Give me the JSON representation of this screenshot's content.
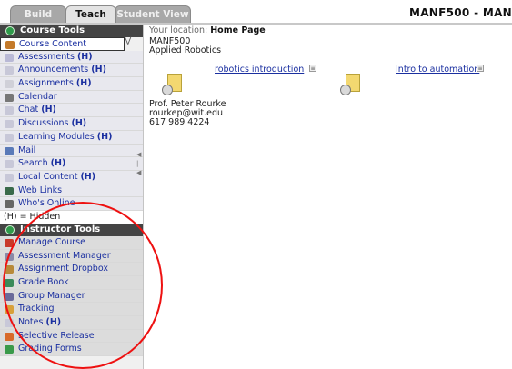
{
  "tabs": [
    {
      "label": "Build"
    },
    {
      "label": "Teach"
    },
    {
      "label": "Student View"
    }
  ],
  "course_title": "MANF500 - MAN",
  "course_tools": {
    "header": "Course Tools",
    "items": [
      {
        "label": "Course Content",
        "hidden": ""
      },
      {
        "label": "Assessments",
        "hidden": "(H)"
      },
      {
        "label": "Announcements",
        "hidden": "(H)"
      },
      {
        "label": "Assignments",
        "hidden": "(H)"
      },
      {
        "label": "Calendar",
        "hidden": ""
      },
      {
        "label": "Chat",
        "hidden": "(H)"
      },
      {
        "label": "Discussions",
        "hidden": "(H)"
      },
      {
        "label": "Learning Modules",
        "hidden": "(H)"
      },
      {
        "label": "Mail",
        "hidden": ""
      },
      {
        "label": "Search",
        "hidden": "(H)"
      },
      {
        "label": "Local Content",
        "hidden": "(H)"
      },
      {
        "label": "Web Links",
        "hidden": ""
      },
      {
        "label": "Who's Online",
        "hidden": ""
      }
    ],
    "hidden_note": "(H) = Hidden"
  },
  "instructor_tools": {
    "header": "Instructor Tools",
    "items": [
      {
        "label": "Manage Course",
        "hidden": ""
      },
      {
        "label": "Assessment Manager",
        "hidden": ""
      },
      {
        "label": "Assignment Dropbox",
        "hidden": ""
      },
      {
        "label": "Grade Book",
        "hidden": ""
      },
      {
        "label": "Group Manager",
        "hidden": ""
      },
      {
        "label": "Tracking",
        "hidden": ""
      },
      {
        "label": "Notes",
        "hidden": "(H)"
      },
      {
        "label": "Selective Release",
        "hidden": ""
      },
      {
        "label": "Grading Forms",
        "hidden": ""
      }
    ]
  },
  "main": {
    "location_label": "Your location:",
    "location_value": "Home Page",
    "course_code": "MANF500",
    "course_name": "Applied Robotics",
    "items": [
      {
        "link": "robotics introduction"
      },
      {
        "link": "Intro to automation"
      }
    ],
    "prof_name": "Prof. Peter Rourke",
    "prof_email": "rourkep@wit.edu",
    "prof_phone": "617 989 4224"
  },
  "colors": {
    "link": "#1a2fa0",
    "header_bg": "#444444",
    "annotation": "#e11111"
  }
}
